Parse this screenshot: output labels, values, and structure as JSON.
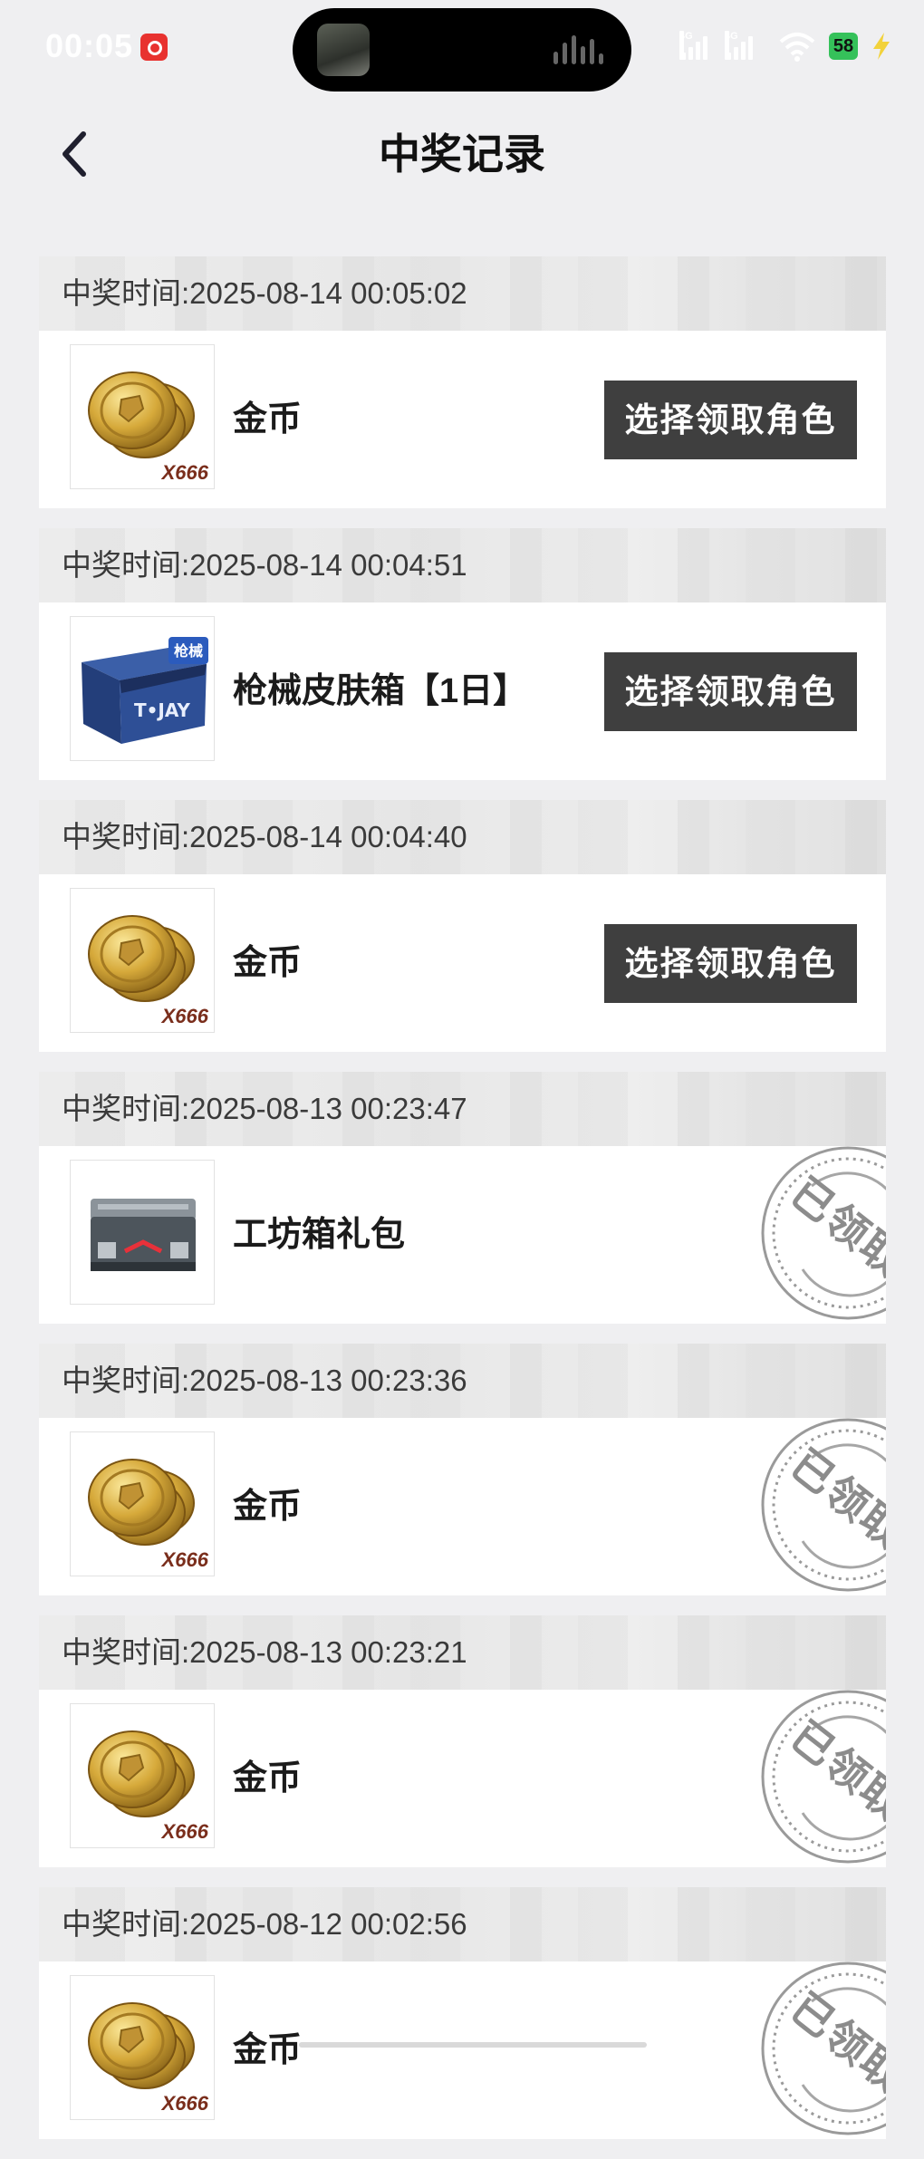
{
  "status_bar": {
    "time": "00:05",
    "battery": "58",
    "signal1": "4G",
    "signal2": "4G"
  },
  "header": {
    "title": "中奖记录"
  },
  "colors": {
    "button_bg": "#3f3f3f",
    "stamp": "#8c8c8c",
    "page_bg": "#efeff1"
  },
  "time_prefix": "中奖时间:",
  "records": [
    {
      "time": "中奖时间:2025-08-14 00:05:02",
      "item": "金币",
      "icon": "gold-coins-icon",
      "qty": "X666",
      "status": "unclaimed",
      "action": "选择领取角色"
    },
    {
      "time": "中奖时间:2025-08-14 00:04:51",
      "item": "枪械皮肤箱【1日】",
      "icon": "weapon-skin-box-icon",
      "qty": "",
      "tag": "枪械",
      "status": "unclaimed",
      "action": "选择领取角色"
    },
    {
      "time": "中奖时间:2025-08-14 00:04:40",
      "item": "金币",
      "icon": "gold-coins-icon",
      "qty": "X666",
      "status": "unclaimed",
      "action": "选择领取角色"
    },
    {
      "time": "中奖时间:2025-08-13 00:23:47",
      "item": "工坊箱礼包",
      "icon": "workshop-box-icon",
      "qty": "",
      "status": "claimed",
      "stamp": "已领取"
    },
    {
      "time": "中奖时间:2025-08-13 00:23:36",
      "item": "金币",
      "icon": "gold-coins-icon",
      "qty": "X666",
      "status": "claimed",
      "stamp": "已领取"
    },
    {
      "time": "中奖时间:2025-08-13 00:23:21",
      "item": "金币",
      "icon": "gold-coins-icon",
      "qty": "X666",
      "status": "claimed",
      "stamp": "已领取"
    },
    {
      "time": "中奖时间:2025-08-12 00:02:56",
      "item": "金币",
      "icon": "gold-coins-icon",
      "qty": "X666",
      "status": "claimed",
      "stamp": "已领取"
    }
  ]
}
